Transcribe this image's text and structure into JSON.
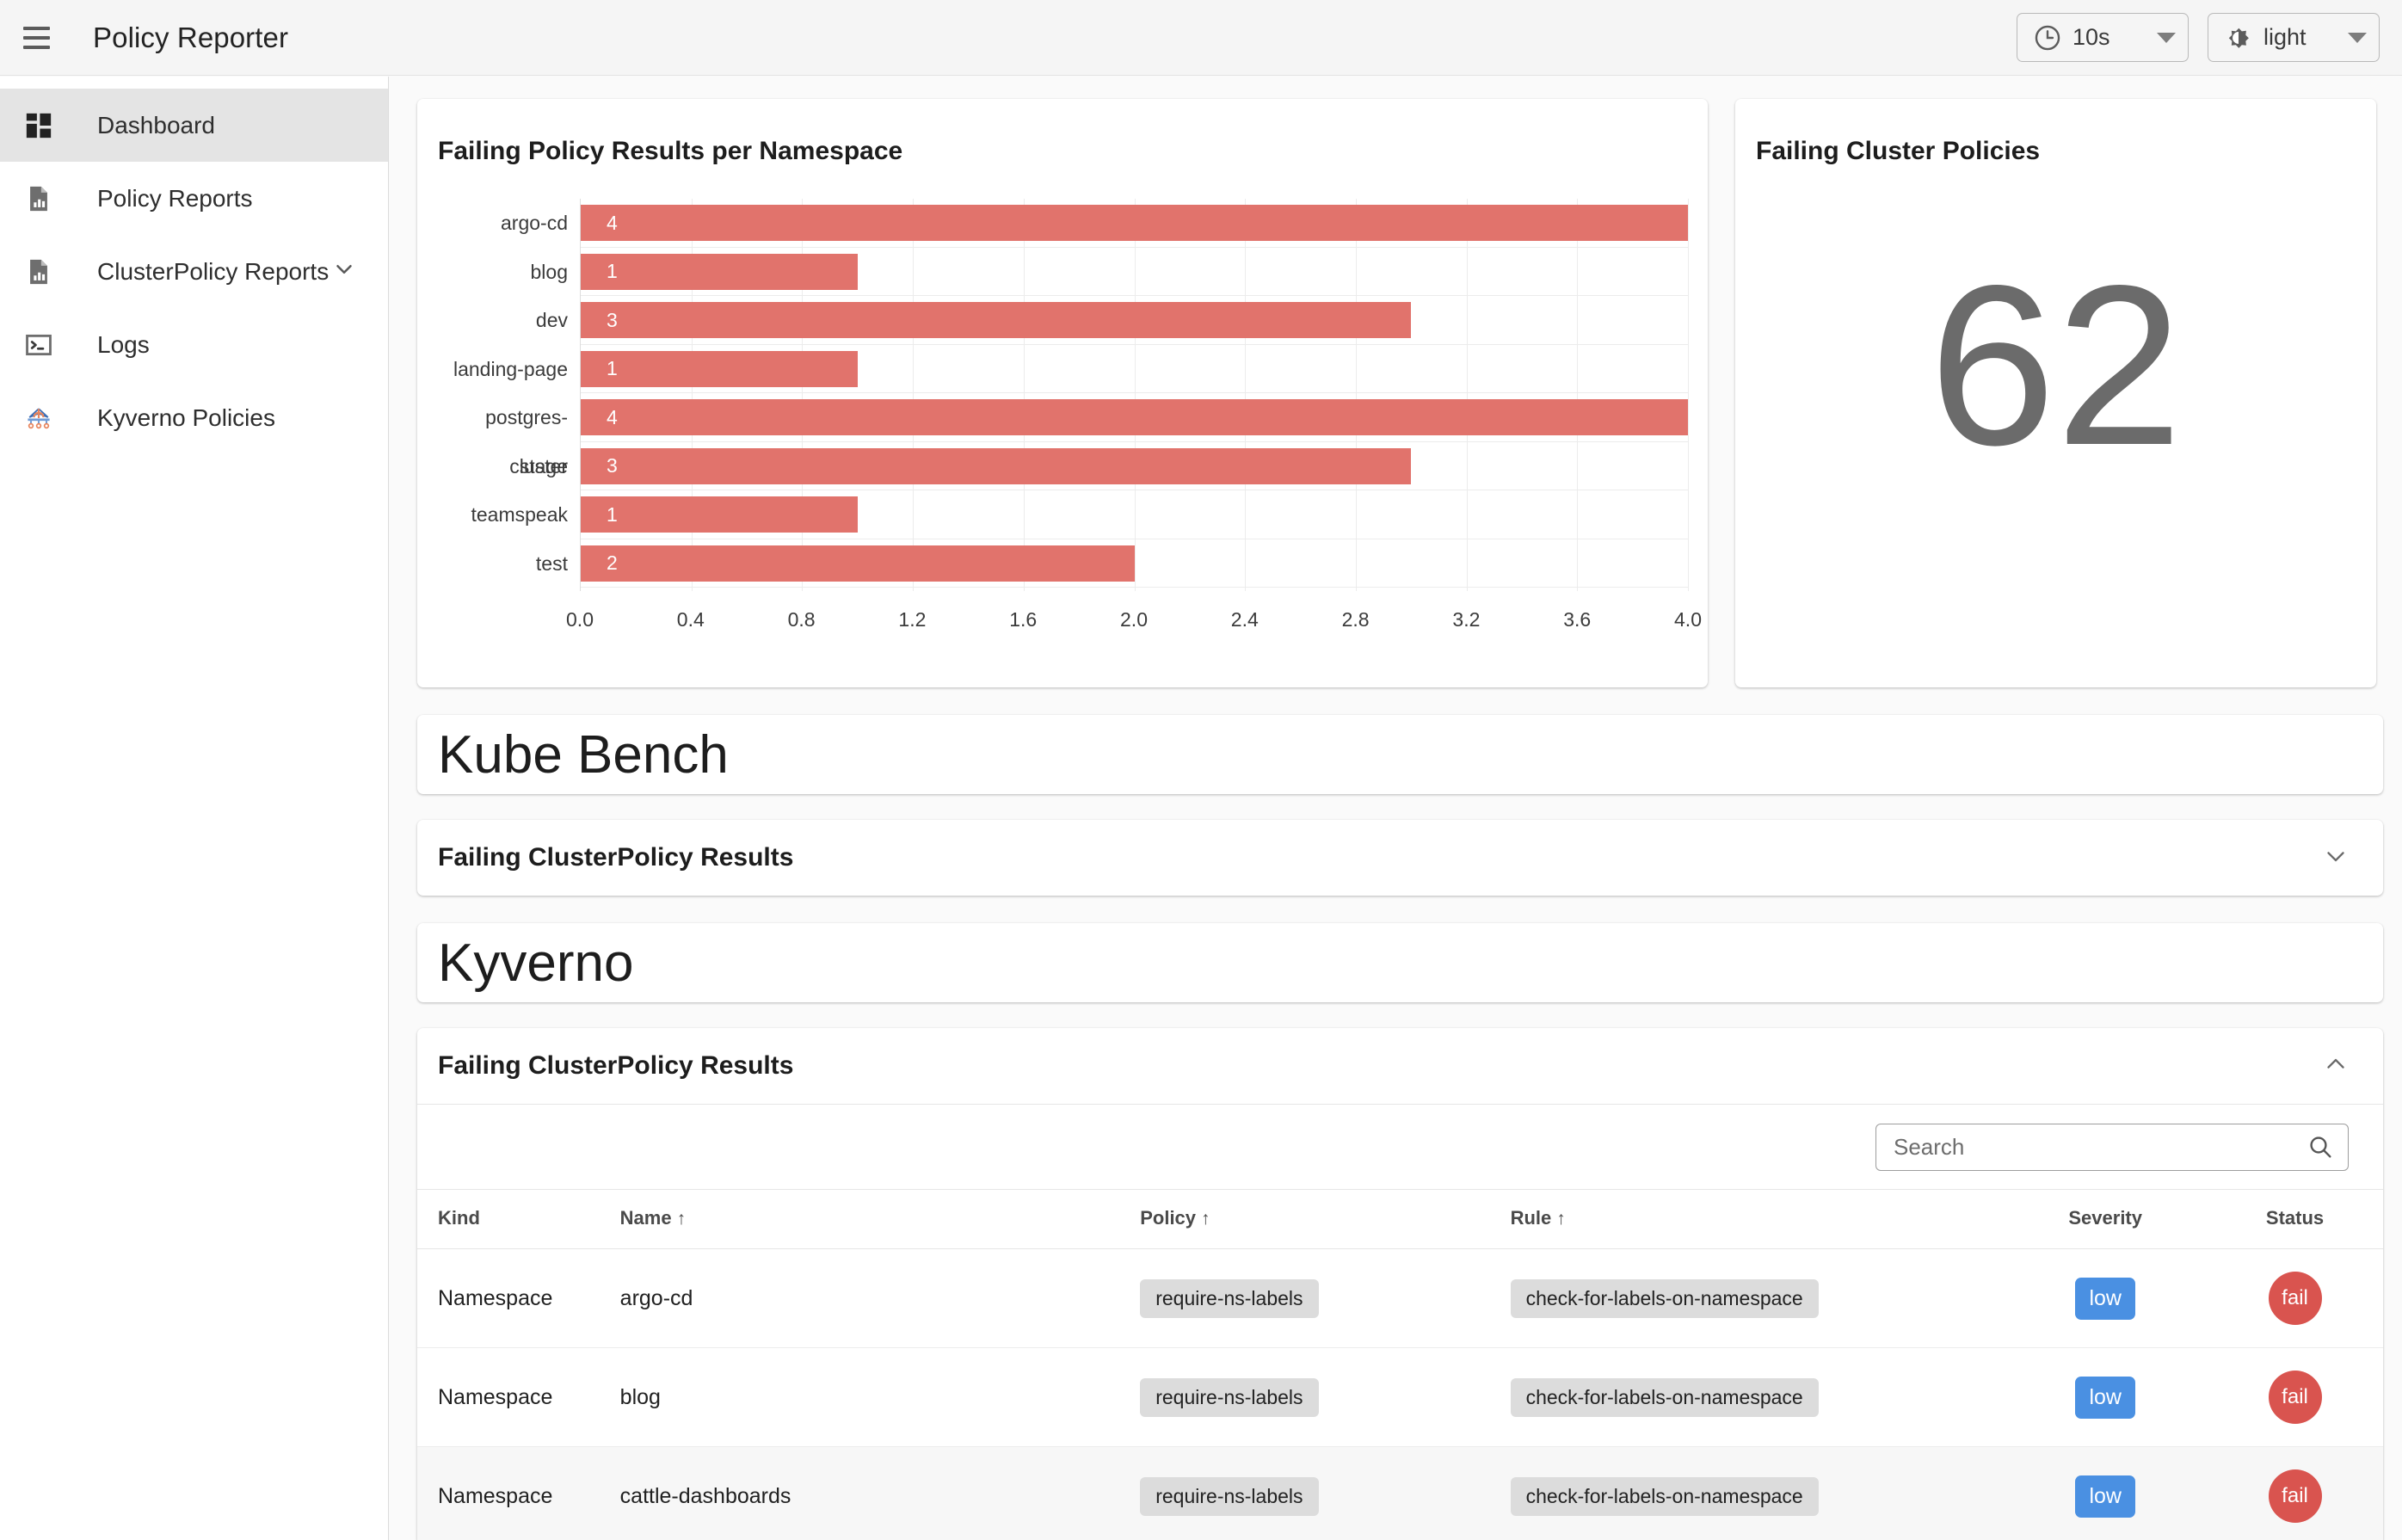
{
  "appbar": {
    "menu_icon": "hamburger-menu-icon",
    "title": "Policy Reporter",
    "refresh_interval": {
      "icon": "clock-icon",
      "label": "10s",
      "caret": "chevron-down-icon"
    },
    "theme": {
      "icon": "brightness-icon",
      "label": "light",
      "caret": "chevron-down-icon"
    }
  },
  "sidebar": {
    "items": [
      {
        "label": "Dashboard",
        "icon": "dashboard-grid-icon",
        "active": true,
        "expandable": false
      },
      {
        "label": "Policy Reports",
        "icon": "report-document-icon",
        "active": false,
        "expandable": false
      },
      {
        "label": "ClusterPolicy Reports",
        "icon": "report-document-icon",
        "active": false,
        "expandable": true,
        "chevron": "chevron-down-icon"
      },
      {
        "label": "Logs",
        "icon": "terminal-icon",
        "active": false,
        "expandable": false
      },
      {
        "label": "Kyverno Policies",
        "icon": "kyverno-logo-icon",
        "active": false,
        "expandable": false
      }
    ]
  },
  "cards": {
    "chart_title": "Failing Policy Results per Namespace",
    "count_title": "Failing Cluster Policies",
    "count_value": "62"
  },
  "chart_data": {
    "type": "bar",
    "orientation": "horizontal",
    "title": "Failing Policy Results per Namespace",
    "xlabel": "",
    "ylabel": "",
    "categories": [
      "argo-cd",
      "blog",
      "dev",
      "landing-page",
      "postgres-cluster",
      "stage",
      "teamspeak",
      "test"
    ],
    "values": [
      4,
      1,
      3,
      1,
      4,
      3,
      1,
      2
    ],
    "bar_labels": [
      "4",
      "1",
      "3",
      "1",
      "4",
      "3",
      "1",
      "2"
    ],
    "bar_color": "#e1736c",
    "xlim": [
      0,
      4
    ],
    "xticks": [
      "0.0",
      "0.4",
      "0.8",
      "1.2",
      "1.6",
      "2.0",
      "2.4",
      "2.8",
      "3.2",
      "3.6",
      "4.0"
    ],
    "grid": true,
    "legend": false
  },
  "sections": [
    {
      "banner": "Kube Bench",
      "panel_title": "Failing ClusterPolicy Results",
      "expanded": false,
      "chevron": "chevron-down-icon"
    },
    {
      "banner": "Kyverno",
      "panel_title": "Failing ClusterPolicy Results",
      "expanded": true,
      "chevron": "chevron-up-icon"
    }
  ],
  "search": {
    "placeholder": "Search",
    "value": "",
    "icon": "search-icon"
  },
  "table": {
    "columns": [
      {
        "label": "Kind",
        "sortable": false
      },
      {
        "label": "Name",
        "sortable": true,
        "sort_icon": "arrow-up-icon"
      },
      {
        "label": "Policy",
        "sortable": true,
        "sort_icon": "arrow-up-icon"
      },
      {
        "label": "Rule",
        "sortable": true,
        "sort_icon": "arrow-up-icon"
      },
      {
        "label": "Severity",
        "sortable": false
      },
      {
        "label": "Status",
        "sortable": false
      }
    ],
    "rows": [
      {
        "kind": "Namespace",
        "name": "argo-cd",
        "policy": "require-ns-labels",
        "rule": "check-for-labels-on-namespace",
        "severity": "low",
        "status": "fail"
      },
      {
        "kind": "Namespace",
        "name": "blog",
        "policy": "require-ns-labels",
        "rule": "check-for-labels-on-namespace",
        "severity": "low",
        "status": "fail"
      },
      {
        "kind": "Namespace",
        "name": "cattle-dashboards",
        "policy": "require-ns-labels",
        "rule": "check-for-labels-on-namespace",
        "severity": "low",
        "status": "fail"
      }
    ]
  },
  "colors": {
    "bar": "#e1736c",
    "severity_low": "#4a90e2",
    "status_fail": "#d9544f",
    "sidebar_active": "#e4e4e4",
    "page_bg": "#fafafa"
  }
}
